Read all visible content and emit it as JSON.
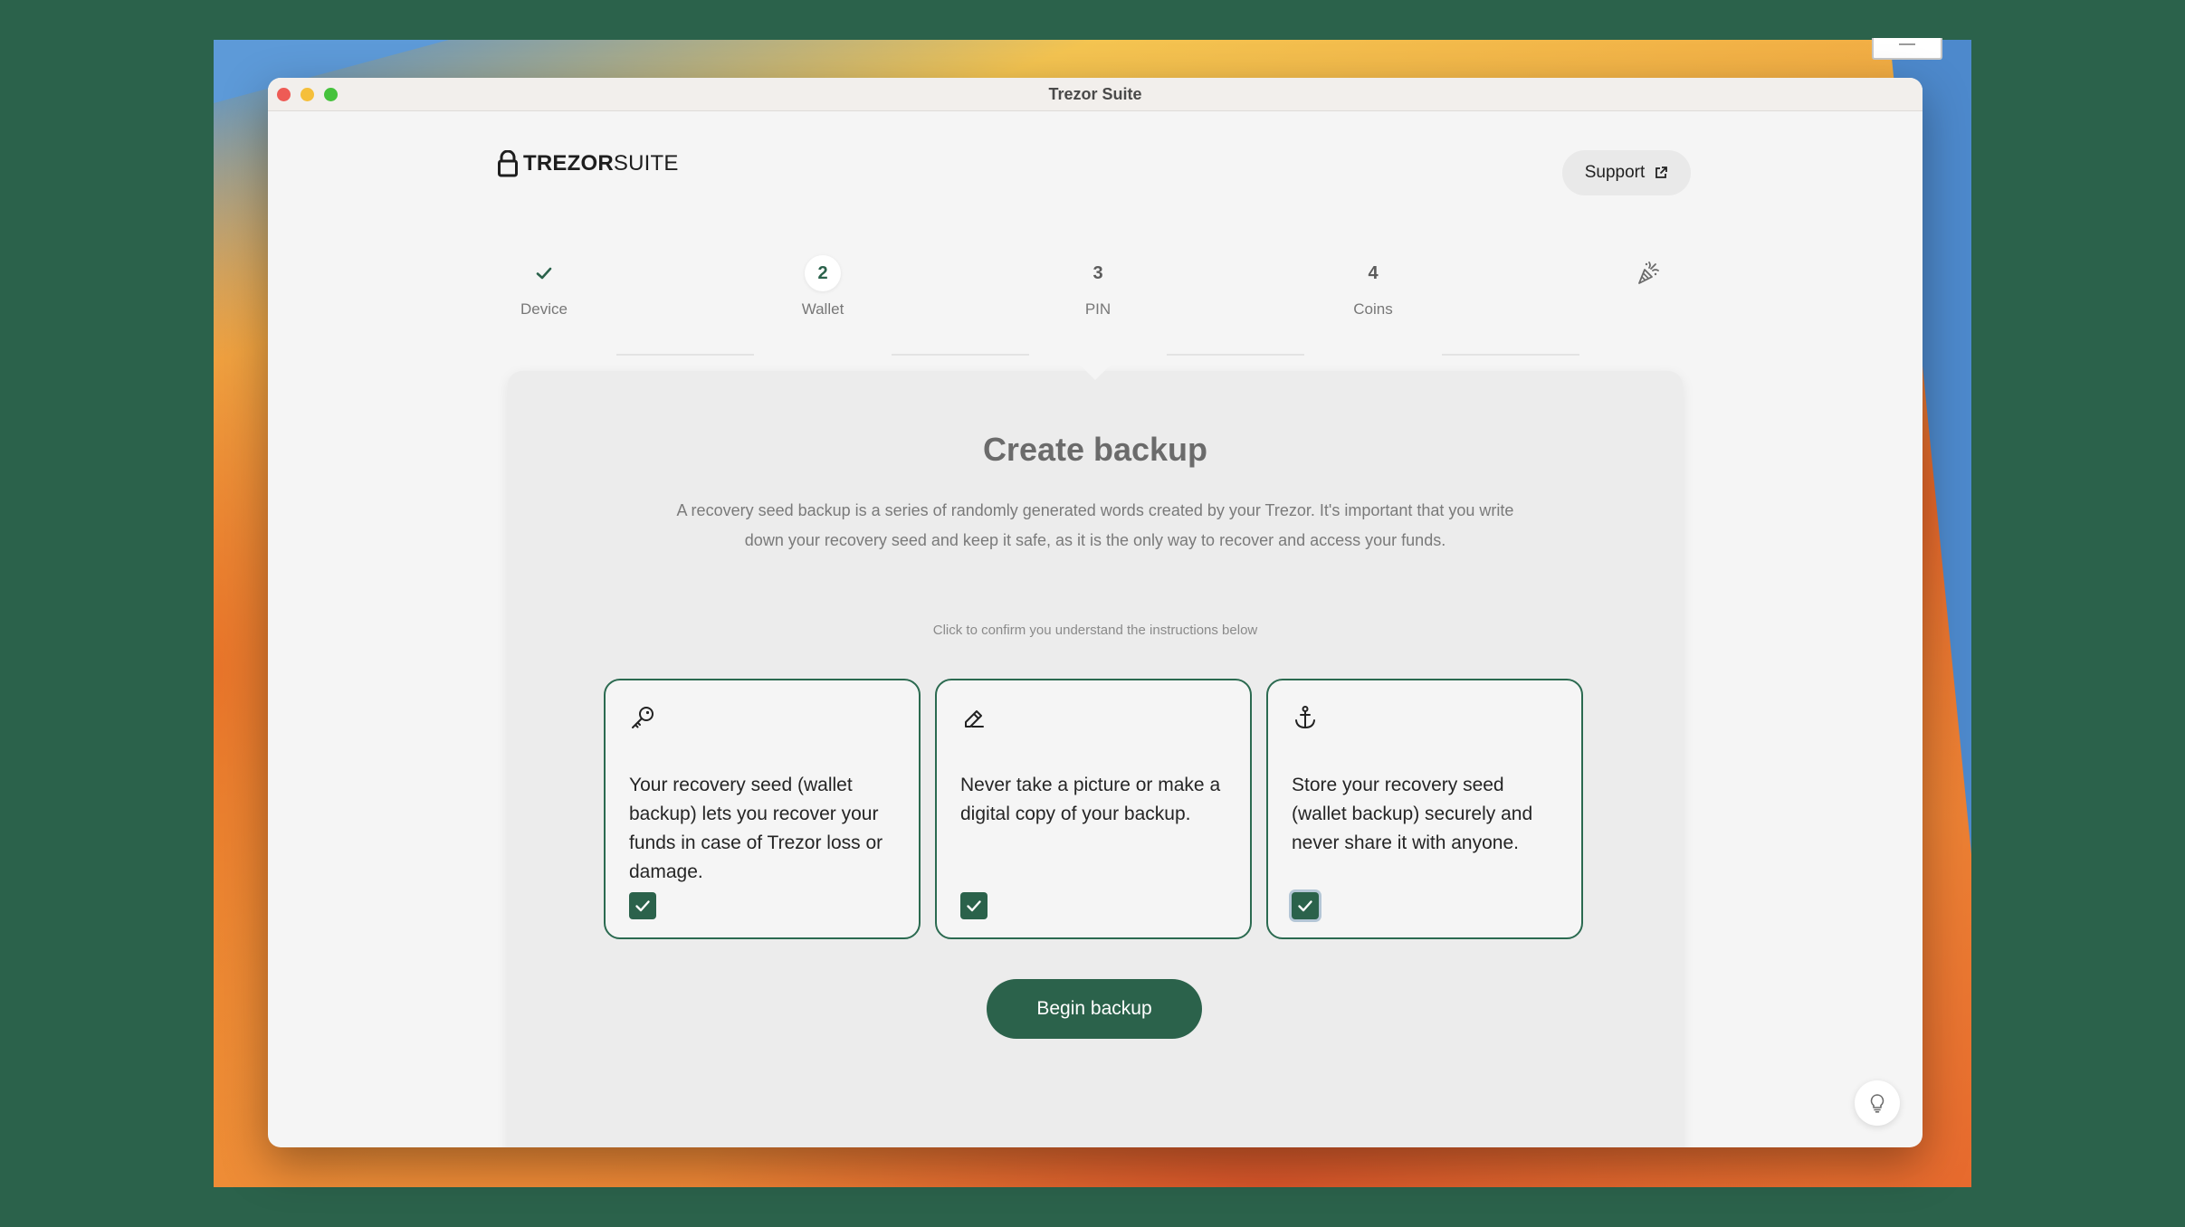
{
  "window": {
    "title": "Trezor Suite"
  },
  "brand": {
    "name_bold": "TREZOR",
    "name_light": "SUITE"
  },
  "header": {
    "support_label": "Support"
  },
  "steps": [
    {
      "label": "Device",
      "state": "done",
      "icon": "check-icon"
    },
    {
      "number": "2",
      "label": "Wallet",
      "state": "active"
    },
    {
      "number": "3",
      "label": "PIN",
      "state": "pending"
    },
    {
      "number": "4",
      "label": "Coins",
      "state": "pending"
    },
    {
      "label": "",
      "state": "final",
      "icon": "party-popper-icon"
    }
  ],
  "content": {
    "title": "Create backup",
    "description": "A recovery seed backup is a series of randomly generated words created by your Trezor. It's important that you write down your recovery seed and keep it safe, as it is the only way to recover and access your funds.",
    "hint": "Click to confirm you understand the instructions below",
    "confirmations": [
      {
        "icon": "key-icon",
        "text": "Your recovery seed (wallet backup) lets you recover your funds in case of Trezor loss or damage.",
        "checked": true
      },
      {
        "icon": "pencil-icon",
        "text": "Never take a picture or make a digital copy of your backup.",
        "checked": true
      },
      {
        "icon": "anchor-icon",
        "text": "Store your recovery seed (wallet backup) securely and never share it with anyone.",
        "checked": true
      }
    ],
    "primary_button": "Begin backup"
  },
  "colors": {
    "brand_green": "#2b624b",
    "background": "#f5f5f5"
  }
}
